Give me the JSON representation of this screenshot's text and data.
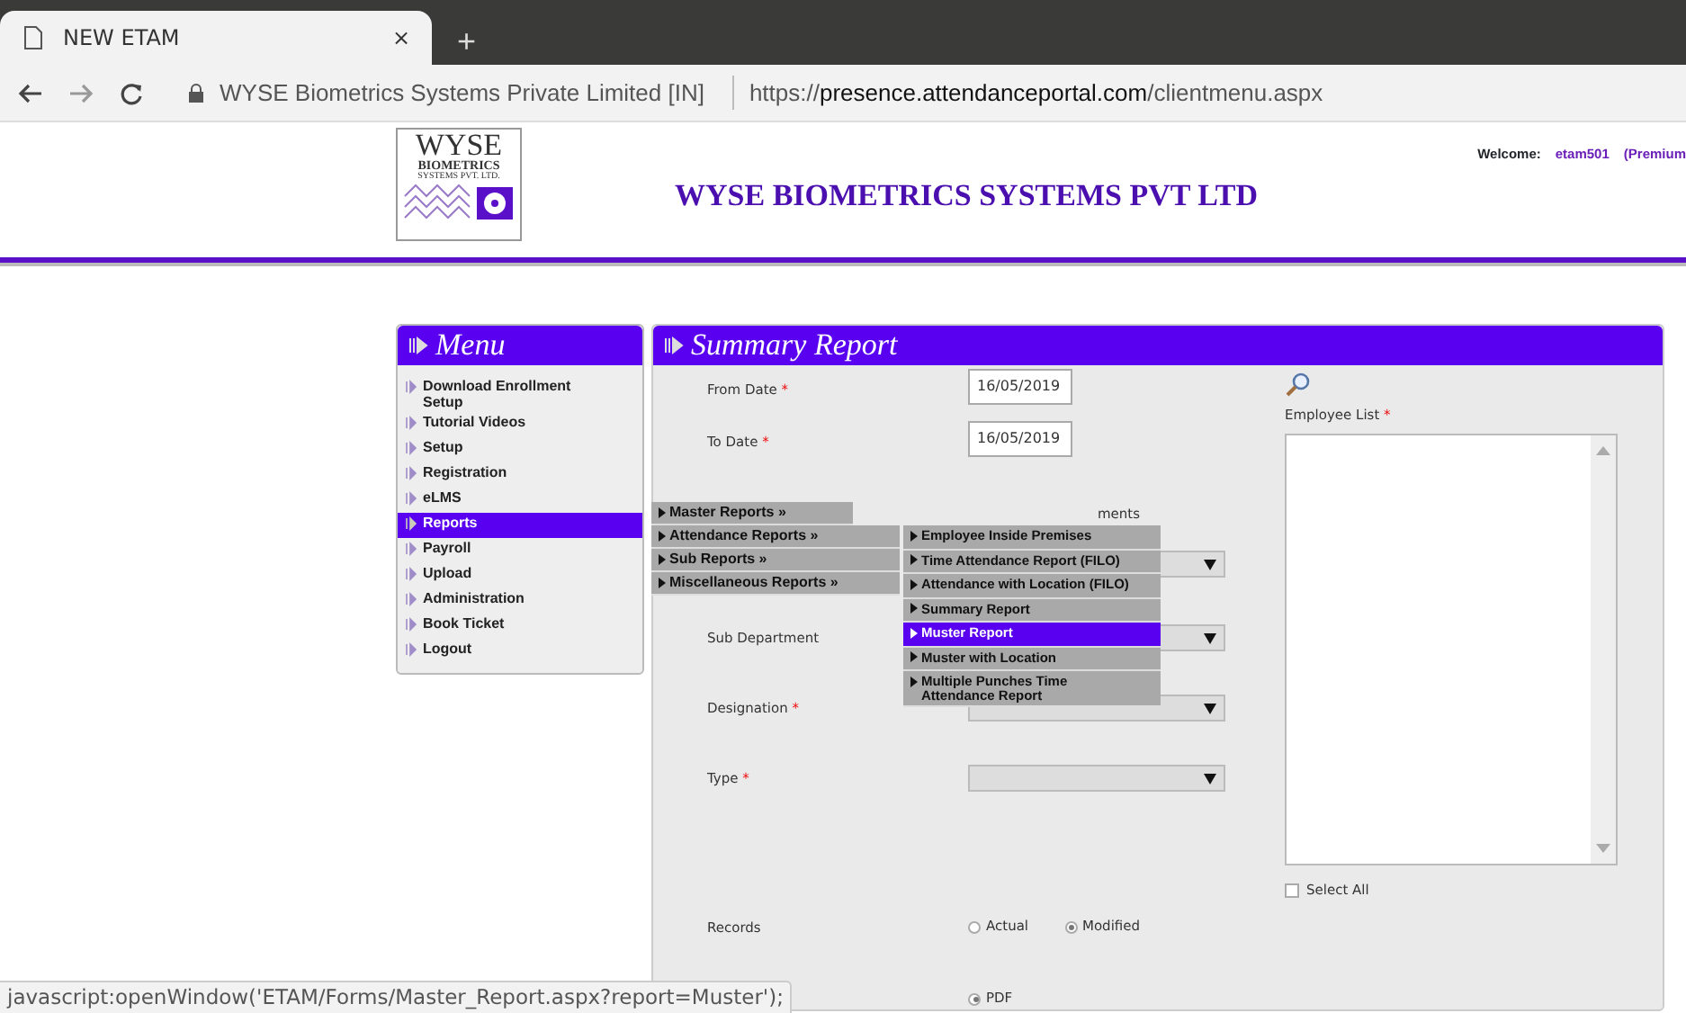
{
  "browser": {
    "tab_title": "NEW ETAM",
    "tab_close": "×",
    "new_tab": "+",
    "site_identity": "WYSE Biometrics Systems Private Limited [IN]",
    "url_scheme": "https://",
    "url_host": "presence.attendanceportal.com",
    "url_path": "/clientmenu.aspx"
  },
  "header": {
    "logo_lines": [
      "WYSE",
      "BIOMETRICS",
      "SYSTEMS PVT. LTD."
    ],
    "title": "WYSE BIOMETRICS SYSTEMS PVT LTD",
    "welcome_label": "Welcome:",
    "user": "etam501",
    "plan": "(Premium"
  },
  "menu": {
    "title": "Menu",
    "items": [
      {
        "label": "Download Enrollment Setup",
        "selected": false
      },
      {
        "label": "Tutorial Videos",
        "selected": false
      },
      {
        "label": "Setup",
        "selected": false
      },
      {
        "label": "Registration",
        "selected": false
      },
      {
        "label": "eLMS",
        "selected": false
      },
      {
        "label": "Reports",
        "selected": true
      },
      {
        "label": "Payroll",
        "selected": false
      },
      {
        "label": "Upload",
        "selected": false
      },
      {
        "label": "Administration",
        "selected": false
      },
      {
        "label": "Book Ticket",
        "selected": false
      },
      {
        "label": "Logout",
        "selected": false
      }
    ]
  },
  "reports_flyout": {
    "items": [
      {
        "label": "Master Reports »"
      },
      {
        "label": "Attendance Reports »"
      },
      {
        "label": "Sub Reports »"
      },
      {
        "label": "Miscellaneous Reports »"
      }
    ]
  },
  "attendance_submenu": {
    "items": [
      {
        "label": "Employee Inside Premises",
        "selected": false
      },
      {
        "label": "Time Attendance Report (FILO)",
        "selected": false
      },
      {
        "label": "Attendance with Location (FILO)",
        "selected": false
      },
      {
        "label": "Summary Report",
        "selected": false
      },
      {
        "label": "Muster Report",
        "selected": true
      },
      {
        "label": "Muster with Location",
        "selected": false
      },
      {
        "label": "Multiple Punches Time Attendance Report",
        "selected": false
      }
    ]
  },
  "form": {
    "title": "Summary Report",
    "fields": [
      {
        "kind": "date",
        "label": "From Date",
        "required_mark": "*",
        "value": "16/05/2019"
      },
      {
        "kind": "date",
        "label": "To Date",
        "required_mark": "*",
        "value": "16/05/2019"
      },
      {
        "kind": "covered",
        "label": "ments"
      },
      {
        "kind": "select",
        "label": "Sub Department"
      },
      {
        "kind": "select",
        "label": "Designation",
        "required_mark": "*"
      },
      {
        "kind": "select",
        "label": "Type",
        "required_mark": "*"
      },
      {
        "kind": "radio",
        "label": "Records",
        "options": [
          {
            "label": "Actual",
            "selected": false
          },
          {
            "label": "Modified",
            "selected": true
          }
        ]
      },
      {
        "kind": "radio",
        "options": [
          {
            "label": "PDF",
            "selected": true
          }
        ]
      }
    ],
    "employee_list": {
      "label": "Employee List",
      "required_mark": "*"
    },
    "select_all": {
      "label": "Select All",
      "checked": false
    }
  },
  "status_url": "javascript:openWindow('ETAM/Forms/Master_Report.aspx?report=Muster');"
}
